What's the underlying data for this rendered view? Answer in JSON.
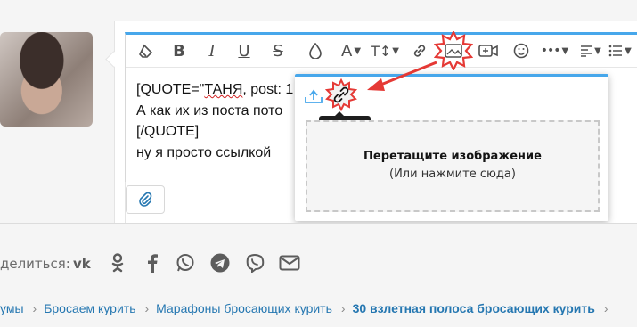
{
  "editor": {
    "toolbar": [
      {
        "name": "clear-format-icon"
      },
      {
        "name": "bold-icon",
        "glyph": "B"
      },
      {
        "name": "italic-icon",
        "glyph": "I"
      },
      {
        "name": "underline-icon",
        "glyph": "U"
      },
      {
        "name": "strikethrough-icon",
        "glyph": "S"
      },
      {
        "name": "text-color-icon"
      },
      {
        "name": "font-family-icon",
        "glyph": "A"
      },
      {
        "name": "font-size-icon",
        "glyph": "T↕"
      },
      {
        "name": "link-icon"
      },
      {
        "name": "image-icon"
      },
      {
        "name": "video-icon"
      },
      {
        "name": "emoji-icon"
      },
      {
        "name": "more-icon"
      },
      {
        "name": "align-icon"
      },
      {
        "name": "list-icon"
      }
    ],
    "content_lines": [
      "[QUOTE=\"ТАНЯ, post: 1",
      "А как их из поста пото",
      "[/QUOTE]",
      "ну я просто ссылкой"
    ],
    "squiggle_word": "ТАНЯ"
  },
  "image_popup": {
    "tooltip": "По URL",
    "drop_title": "Перетащите изображение",
    "drop_sub": "(Или нажмите сюда)",
    "icons": [
      "upload-icon",
      "link-url-icon"
    ]
  },
  "share": {
    "label": "делиться:",
    "icons": [
      "vk-icon",
      "odnoklassniki-icon",
      "facebook-icon",
      "whatsapp-icon",
      "telegram-icon",
      "viber-icon",
      "email-icon"
    ]
  },
  "breadcrumbs": {
    "items": [
      "умы",
      "Бросаем курить",
      "Марафоны бросающих курить",
      "30 взлетная полоса бросающих курить"
    ],
    "separator": "›"
  },
  "colors": {
    "accent": "#47a7eb",
    "link": "#2577b1",
    "annotation": "#e53935"
  }
}
